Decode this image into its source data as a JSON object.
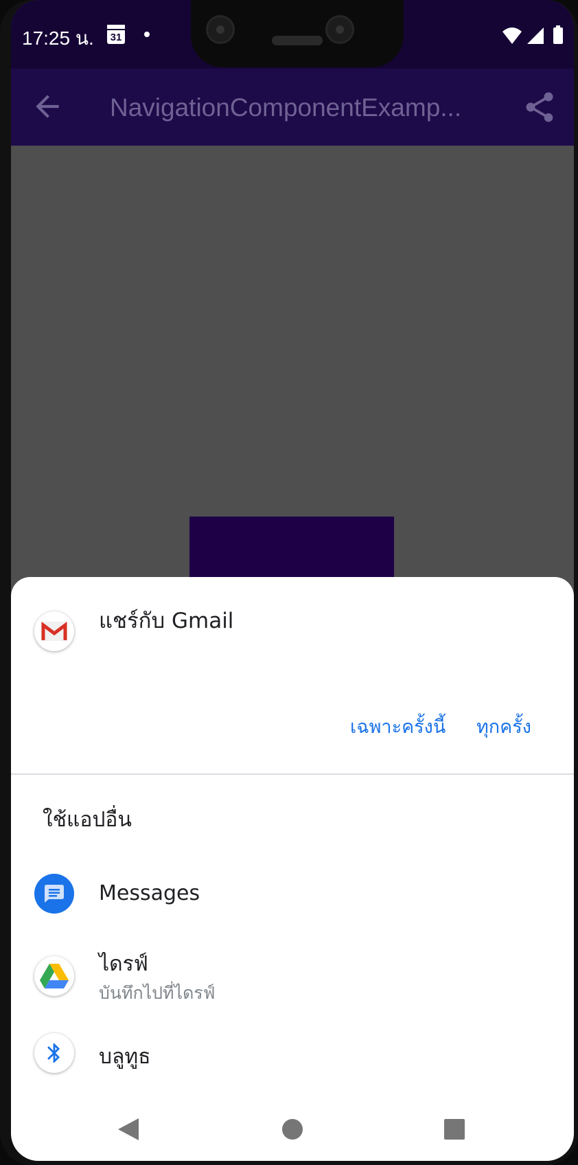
{
  "status_bar": {
    "time": "17:25 น.",
    "calendar_day": "31"
  },
  "app_bar": {
    "title": "NavigationComponentExamp..."
  },
  "share_sheet": {
    "default_app": {
      "label": "แชร์กับ Gmail",
      "icon": "gmail-icon"
    },
    "actions": {
      "just_once": "เฉพาะครั้งนี้",
      "always": "ทุกครั้ง"
    },
    "other_apps_heading": "ใช้แอปอื่น",
    "apps": [
      {
        "label": "Messages",
        "sublabel": "",
        "icon": "messages-icon"
      },
      {
        "label": "ไดรฟ์",
        "sublabel": "บันทึกไปที่ไดรฟ์",
        "icon": "google-drive-icon"
      },
      {
        "label": "บลูทูธ",
        "sublabel": "",
        "icon": "bluetooth-icon"
      }
    ]
  },
  "colors": {
    "status_bar": "#150535",
    "app_bar": "#1d0a49",
    "content_background": "#4f4f4f",
    "accent_button": "#1e0047",
    "link_blue": "#1a73e8"
  }
}
